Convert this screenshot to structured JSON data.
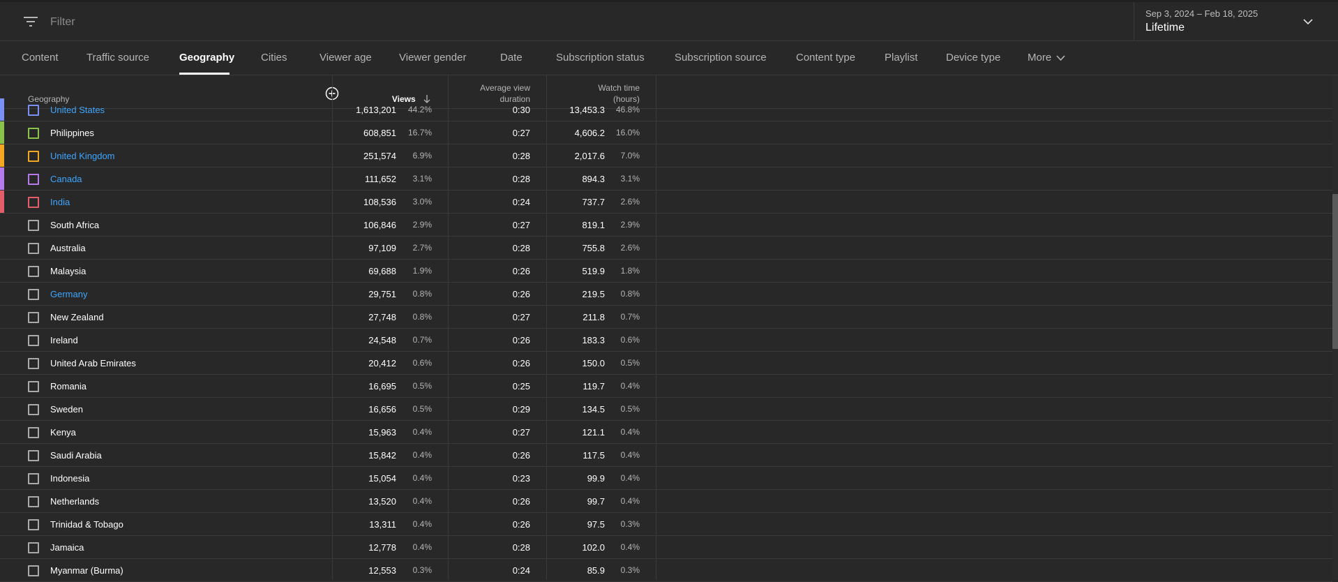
{
  "filter": {
    "placeholder": "Filter"
  },
  "date_range": {
    "range": "Sep 3, 2024 – Feb 18, 2025",
    "period": "Lifetime"
  },
  "tabs": [
    {
      "label": "Content",
      "active": false
    },
    {
      "label": "Traffic source",
      "active": false
    },
    {
      "label": "Geography",
      "active": true
    },
    {
      "label": "Cities",
      "active": false
    },
    {
      "label": "Viewer age",
      "active": false
    },
    {
      "label": "Viewer gender",
      "active": false
    },
    {
      "label": "Date",
      "active": false
    },
    {
      "label": "Subscription status",
      "active": false
    },
    {
      "label": "Subscription source",
      "active": false
    },
    {
      "label": "Content type",
      "active": false
    },
    {
      "label": "Playlist",
      "active": false
    },
    {
      "label": "Device type",
      "active": false
    },
    {
      "label": "More",
      "active": false
    }
  ],
  "table": {
    "headers": {
      "geography": "Geography",
      "views": "Views",
      "avg_view_duration_line1": "Average view",
      "avg_view_duration_line2": "duration",
      "watch_time_line1": "Watch time",
      "watch_time_line2": "(hours)"
    },
    "rows": [
      {
        "name": "United States",
        "views": "1,613,201",
        "views_pct": "44.2%",
        "avg": "0:30",
        "watch": "13,453.3",
        "watch_pct": "46.8%",
        "link": true,
        "color": "#7b8ff5"
      },
      {
        "name": "Philippines",
        "views": "608,851",
        "views_pct": "16.7%",
        "avg": "0:27",
        "watch": "4,606.2",
        "watch_pct": "16.0%",
        "link": false,
        "color": "#8bc34a"
      },
      {
        "name": "United Kingdom",
        "views": "251,574",
        "views_pct": "6.9%",
        "avg": "0:28",
        "watch": "2,017.6",
        "watch_pct": "7.0%",
        "link": true,
        "color": "#f5a623"
      },
      {
        "name": "Canada",
        "views": "111,652",
        "views_pct": "3.1%",
        "avg": "0:28",
        "watch": "894.3",
        "watch_pct": "3.1%",
        "link": true,
        "color": "#b57bee"
      },
      {
        "name": "India",
        "views": "108,536",
        "views_pct": "3.0%",
        "avg": "0:24",
        "watch": "737.7",
        "watch_pct": "2.6%",
        "link": true,
        "color": "#e35d6a"
      },
      {
        "name": "South Africa",
        "views": "106,846",
        "views_pct": "2.9%",
        "avg": "0:27",
        "watch": "819.1",
        "watch_pct": "2.9%",
        "link": false,
        "color": ""
      },
      {
        "name": "Australia",
        "views": "97,109",
        "views_pct": "2.7%",
        "avg": "0:28",
        "watch": "755.8",
        "watch_pct": "2.6%",
        "link": false,
        "color": ""
      },
      {
        "name": "Malaysia",
        "views": "69,688",
        "views_pct": "1.9%",
        "avg": "0:26",
        "watch": "519.9",
        "watch_pct": "1.8%",
        "link": false,
        "color": ""
      },
      {
        "name": "Germany",
        "views": "29,751",
        "views_pct": "0.8%",
        "avg": "0:26",
        "watch": "219.5",
        "watch_pct": "0.8%",
        "link": true,
        "color": ""
      },
      {
        "name": "New Zealand",
        "views": "27,748",
        "views_pct": "0.8%",
        "avg": "0:27",
        "watch": "211.8",
        "watch_pct": "0.7%",
        "link": false,
        "color": ""
      },
      {
        "name": "Ireland",
        "views": "24,548",
        "views_pct": "0.7%",
        "avg": "0:26",
        "watch": "183.3",
        "watch_pct": "0.6%",
        "link": false,
        "color": ""
      },
      {
        "name": "United Arab Emirates",
        "views": "20,412",
        "views_pct": "0.6%",
        "avg": "0:26",
        "watch": "150.0",
        "watch_pct": "0.5%",
        "link": false,
        "color": ""
      },
      {
        "name": "Romania",
        "views": "16,695",
        "views_pct": "0.5%",
        "avg": "0:25",
        "watch": "119.7",
        "watch_pct": "0.4%",
        "link": false,
        "color": ""
      },
      {
        "name": "Sweden",
        "views": "16,656",
        "views_pct": "0.5%",
        "avg": "0:29",
        "watch": "134.5",
        "watch_pct": "0.5%",
        "link": false,
        "color": ""
      },
      {
        "name": "Kenya",
        "views": "15,963",
        "views_pct": "0.4%",
        "avg": "0:27",
        "watch": "121.1",
        "watch_pct": "0.4%",
        "link": false,
        "color": ""
      },
      {
        "name": "Saudi Arabia",
        "views": "15,842",
        "views_pct": "0.4%",
        "avg": "0:26",
        "watch": "117.5",
        "watch_pct": "0.4%",
        "link": false,
        "color": ""
      },
      {
        "name": "Indonesia",
        "views": "15,054",
        "views_pct": "0.4%",
        "avg": "0:23",
        "watch": "99.9",
        "watch_pct": "0.4%",
        "link": false,
        "color": ""
      },
      {
        "name": "Netherlands",
        "views": "13,520",
        "views_pct": "0.4%",
        "avg": "0:26",
        "watch": "99.7",
        "watch_pct": "0.4%",
        "link": false,
        "color": ""
      },
      {
        "name": "Trinidad & Tobago",
        "views": "13,311",
        "views_pct": "0.4%",
        "avg": "0:26",
        "watch": "97.5",
        "watch_pct": "0.3%",
        "link": false,
        "color": ""
      },
      {
        "name": "Jamaica",
        "views": "12,778",
        "views_pct": "0.4%",
        "avg": "0:28",
        "watch": "102.0",
        "watch_pct": "0.4%",
        "link": false,
        "color": ""
      },
      {
        "name": "Myanmar (Burma)",
        "views": "12,553",
        "views_pct": "0.3%",
        "avg": "0:24",
        "watch": "85.9",
        "watch_pct": "0.3%",
        "link": false,
        "color": ""
      }
    ]
  },
  "icons": {
    "filter": "filter-icon",
    "date_dropdown": "chevron-down-icon",
    "add_column": "add-circle-icon",
    "sort": "arrow-down-icon"
  }
}
